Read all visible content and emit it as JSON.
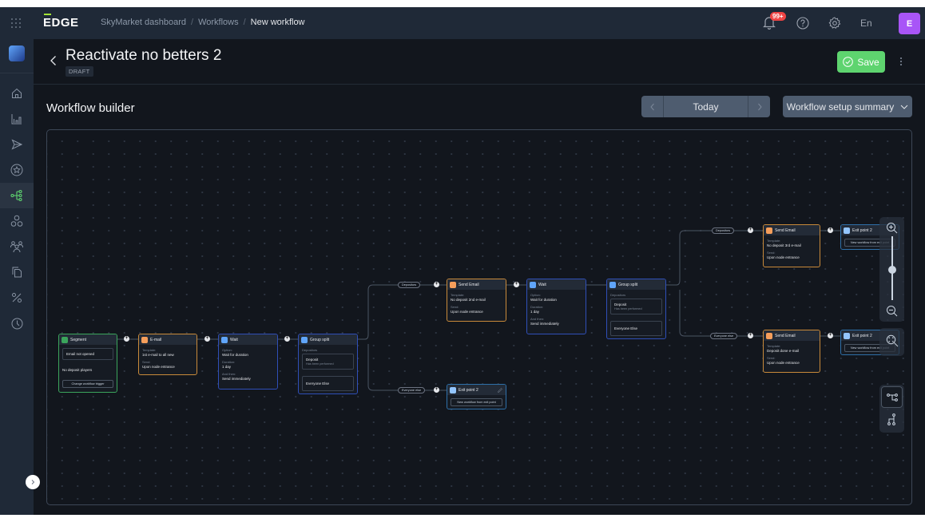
{
  "topbar": {
    "logo": "EDGE",
    "breadcrumbs": [
      "SkyMarket dashboard",
      "Workflows",
      "New workflow"
    ],
    "notifications_badge": "99+",
    "language": "En",
    "avatar_initial": "E",
    "icons": [
      "apps-grid-icon",
      "bell-icon",
      "help-icon",
      "gear-icon"
    ]
  },
  "sidebar": {
    "items": [
      {
        "name": "home",
        "icon": "home-icon",
        "active": false
      },
      {
        "name": "analytics",
        "icon": "bar-chart-icon",
        "active": false
      },
      {
        "name": "campaigns",
        "icon": "send-icon",
        "active": false
      },
      {
        "name": "loyalty",
        "icon": "star-badge-icon",
        "active": false
      },
      {
        "name": "workflows",
        "icon": "workflow-icon",
        "active": true
      },
      {
        "name": "segments",
        "icon": "segments-icon",
        "active": false
      },
      {
        "name": "players",
        "icon": "users-icon",
        "active": false
      },
      {
        "name": "templates",
        "icon": "files-icon",
        "active": false
      },
      {
        "name": "bonuses",
        "icon": "percent-icon",
        "active": false
      },
      {
        "name": "history",
        "icon": "clock-icon",
        "active": false
      }
    ]
  },
  "header": {
    "title": "Reactivate no betters 2",
    "status": "DRAFT",
    "save_label": "Save"
  },
  "builder": {
    "title": "Workflow builder",
    "date_label": "Today",
    "summary_label": "Workflow setup summary"
  },
  "colors": {
    "accent_green": "#5ed46f",
    "segment_border": "#3ba55c",
    "email_border": "#c98a3a",
    "wait_split_border": "#2f4fb8",
    "exit_border": "#2e6fa8",
    "badge_red": "#ef4444",
    "avatar_purple": "#a855f7"
  },
  "nodes": {
    "segment": {
      "title": "Segment",
      "condition": "Email not opened",
      "audience": "No deposit players",
      "button": "Change workflow trigger"
    },
    "email1": {
      "title": "E-mail",
      "template_label": "Template:",
      "template": "1st e-mail to all new",
      "send_label": "Send:",
      "send": "Upon node entrance"
    },
    "wait1": {
      "title": "Wait",
      "option_label": "Option:",
      "option": "Wait for duration",
      "duration_label": "Duration:",
      "duration": "1 day",
      "andthen_label": "And then:",
      "andthen": "Send immediately"
    },
    "split1": {
      "title": "Group split",
      "group_label": "Depositors",
      "branch1": "Deposit",
      "branch1_sub": "Has been performed",
      "branch2": "Everyone Else"
    },
    "pill_dep1": "Depositors",
    "pill_else1": "Everyone else",
    "email2": {
      "title": "Send Email",
      "template_label": "Template:",
      "template": "No deposit 2nd e-mail",
      "send_label": "Send:",
      "send": "Upon node entrance"
    },
    "exit1": {
      "title": "Exit point 2",
      "button": "New workflow from exit point"
    },
    "wait2": {
      "title": "Wait",
      "option_label": "Option:",
      "option": "Wait for duration",
      "duration_label": "Duration:",
      "duration": "1 day",
      "andthen_label": "And then:",
      "andthen": "Send immediately"
    },
    "split2": {
      "title": "Group split",
      "group_label": "Depositors",
      "branch1": "Deposit",
      "branch1_sub": "Has been performed",
      "branch2": "Everyone Else"
    },
    "pill_dep2": "Depositors",
    "pill_else2": "Everyone else",
    "email3": {
      "title": "Send Email",
      "template_label": "Template:",
      "template": "No deposit 3rd e-mail",
      "send_label": "Send:",
      "send": "Upon node entrance"
    },
    "exit2": {
      "title": "Exit point 2",
      "button": "New workflow from exit point"
    },
    "email4": {
      "title": "Send Email",
      "template_label": "Template:",
      "template": "Deposit done e-mail",
      "send_label": "Send:",
      "send": "Upon node entrance"
    },
    "exit3": {
      "title": "Exit point 2",
      "button": "New workflow from exit point"
    }
  },
  "zoom_controls": {
    "zoom_level": 0.5
  }
}
